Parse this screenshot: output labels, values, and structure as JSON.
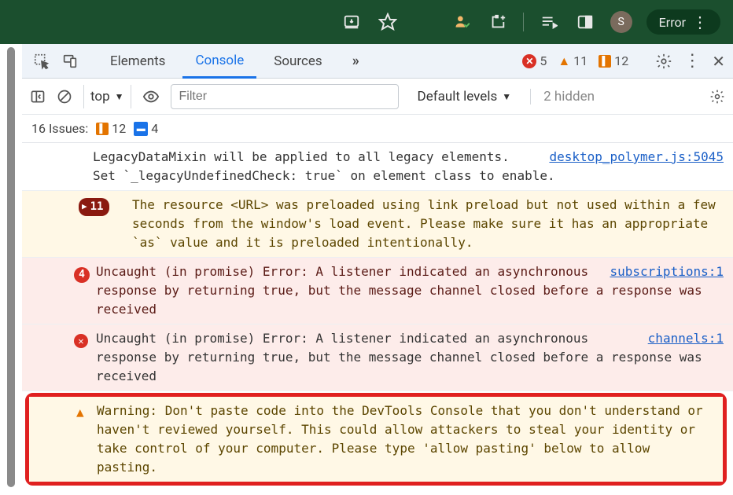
{
  "browser": {
    "avatar_letter": "S",
    "error_pill": "Error"
  },
  "tabs": {
    "elements": "Elements",
    "console": "Console",
    "sources": "Sources",
    "more": "»"
  },
  "counts": {
    "errors": "5",
    "warnings": "11",
    "info": "12"
  },
  "filter": {
    "context": "top",
    "placeholder": "Filter",
    "levels": "Default levels",
    "hidden": "2 hidden"
  },
  "issues": {
    "label": "16 Issues:",
    "flag_count": "12",
    "chat_count": "4"
  },
  "logs": [
    {
      "type": "info",
      "text": "LegacyDataMixin will be applied to all legacy elements.\nSet `_legacyUndefinedCheck: true` on element class to enable.",
      "source": "desktop_polymer.js:5045"
    },
    {
      "type": "warn-count",
      "count": "11",
      "text": "The resource <URL> was preloaded using link preload but not used within a few seconds from the window's load event. Please make sure it has an appropriate `as` value and it is preloaded intentionally."
    },
    {
      "type": "error-count",
      "count": "4",
      "text": "Uncaught (in promise) Error: A listener indicated an asynchronous response by returning true, but the message channel closed before a response was received",
      "source": "subscriptions:1"
    },
    {
      "type": "error-x",
      "text": "Uncaught (in promise) Error: A listener indicated an asynchronous response by returning true, but the message channel closed before a response was received",
      "source": "channels:1"
    },
    {
      "type": "warn-highlight",
      "text": "Warning: Don't paste code into the DevTools Console that you don't understand or haven't reviewed yourself. This could allow attackers to steal your identity or take control of your computer. Please type 'allow pasting' below to allow pasting."
    }
  ]
}
